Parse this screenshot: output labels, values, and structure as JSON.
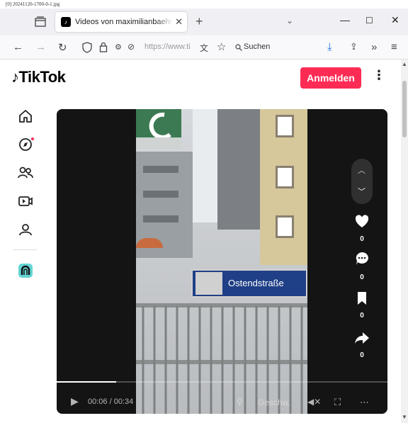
{
  "file_label": "[0] 20241120-1700-0-1.jpg",
  "browser": {
    "tab_title": "Videos von maximilianbaehring",
    "url_partial": "https://www.ti",
    "search_placeholder": "Suchen"
  },
  "tiktok": {
    "logo_text": "TikTok",
    "login_label": "Anmelden",
    "sidebar": [
      "home",
      "explore",
      "following",
      "live",
      "profile",
      "creator"
    ],
    "explore_dot_color": "#fe2c55"
  },
  "video": {
    "current_time": "00:06",
    "duration": "00:34",
    "time_separator": " / ",
    "speed_label": "Geschw.",
    "progress_fraction": 0.18,
    "station_sign_text": "Ostendstraße",
    "like_count": "0",
    "comment_count": "0",
    "save_count": "0",
    "share_count": "0"
  },
  "colors": {
    "accent": "#fe2c55",
    "sbahn_green": "#3b7a52",
    "sign_blue": "#1f3f86"
  }
}
